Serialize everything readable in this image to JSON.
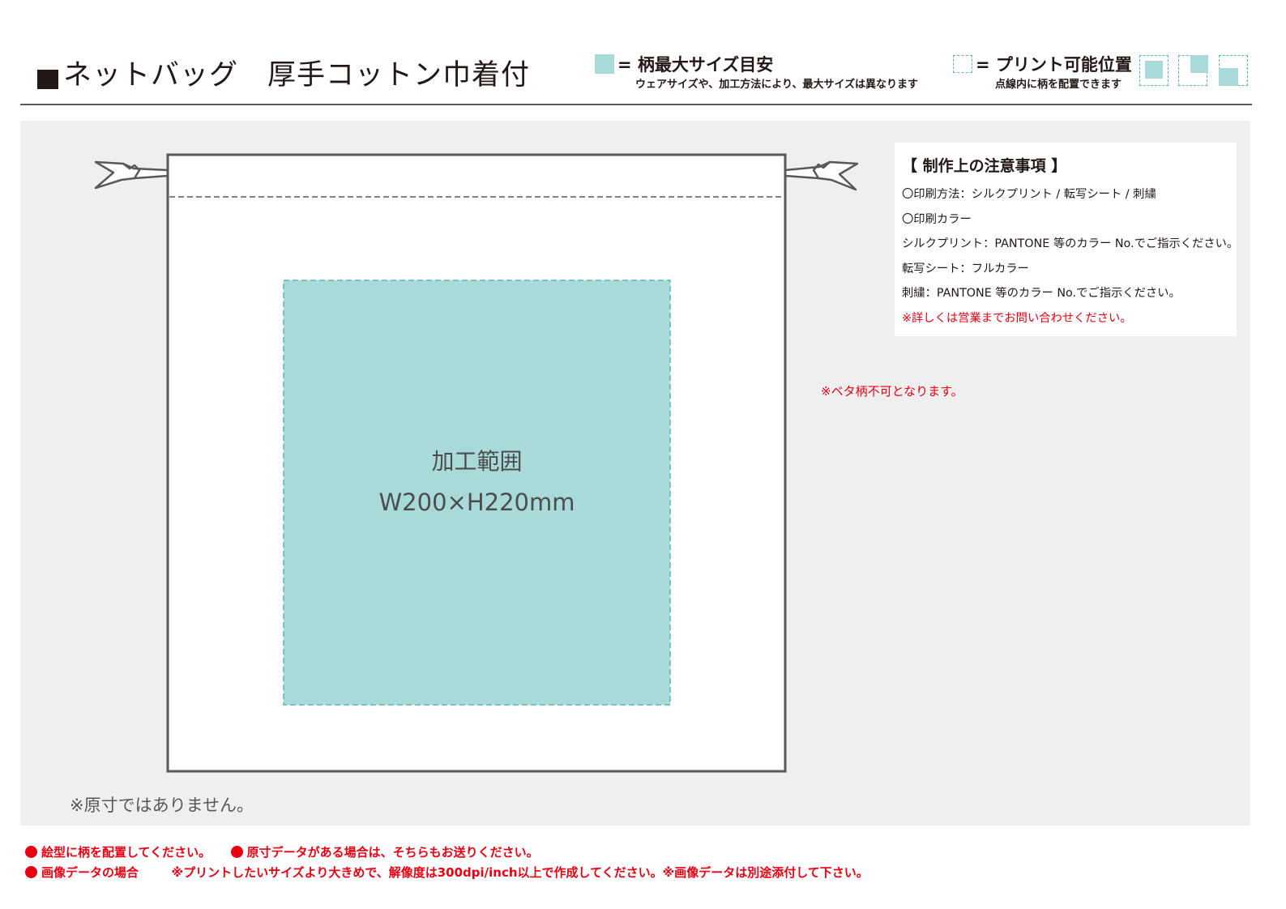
{
  "header": {
    "title": "ネットバッグ　厚手コットン巾着付"
  },
  "legend": {
    "max_size_label": "= 柄最大サイズ目安",
    "max_size_note": "ウェアサイズや、加工方法により、最大サイズは異なります",
    "print_area_label": "= プリント可能位置",
    "print_area_note": "点線内に柄を配置できます"
  },
  "drawing": {
    "area_name": "加工範囲",
    "area_size": "W200×H220mm",
    "not_actual_size": "※原寸ではありません。"
  },
  "notes": {
    "title": "【 制作上の注意事項 】",
    "lines": [
      "〇印刷方法：シルクプリント / 転写シート / 刺繍",
      "〇印刷カラー",
      "シルクプリント：PANTONE 等のカラー No.でご指示ください。",
      "転写シート：フルカラー",
      "刺繍：PANTONE 等のカラー No.でご指示ください。"
    ],
    "red_line": "※詳しくは営業までお問い合わせください。"
  },
  "beta_note": "※ベタ柄不可となります。",
  "footer": {
    "line1_a": "絵型に柄を配置してください。",
    "line1_b": "原寸データがある場合は、そちらもお送りください。",
    "line2_a": "画像データの場合",
    "line2_b": "※プリントしたいサイズより大きめで、解像度は300dpi/inch以上で作成してください。※画像データは別途添付して下さい。"
  },
  "colors": {
    "print_area_fill": "#a8dad9",
    "dashed_border": "#5fb7b4",
    "canvas_background": "#eeefee",
    "note_red": "#e60012",
    "outline": "#595757"
  }
}
